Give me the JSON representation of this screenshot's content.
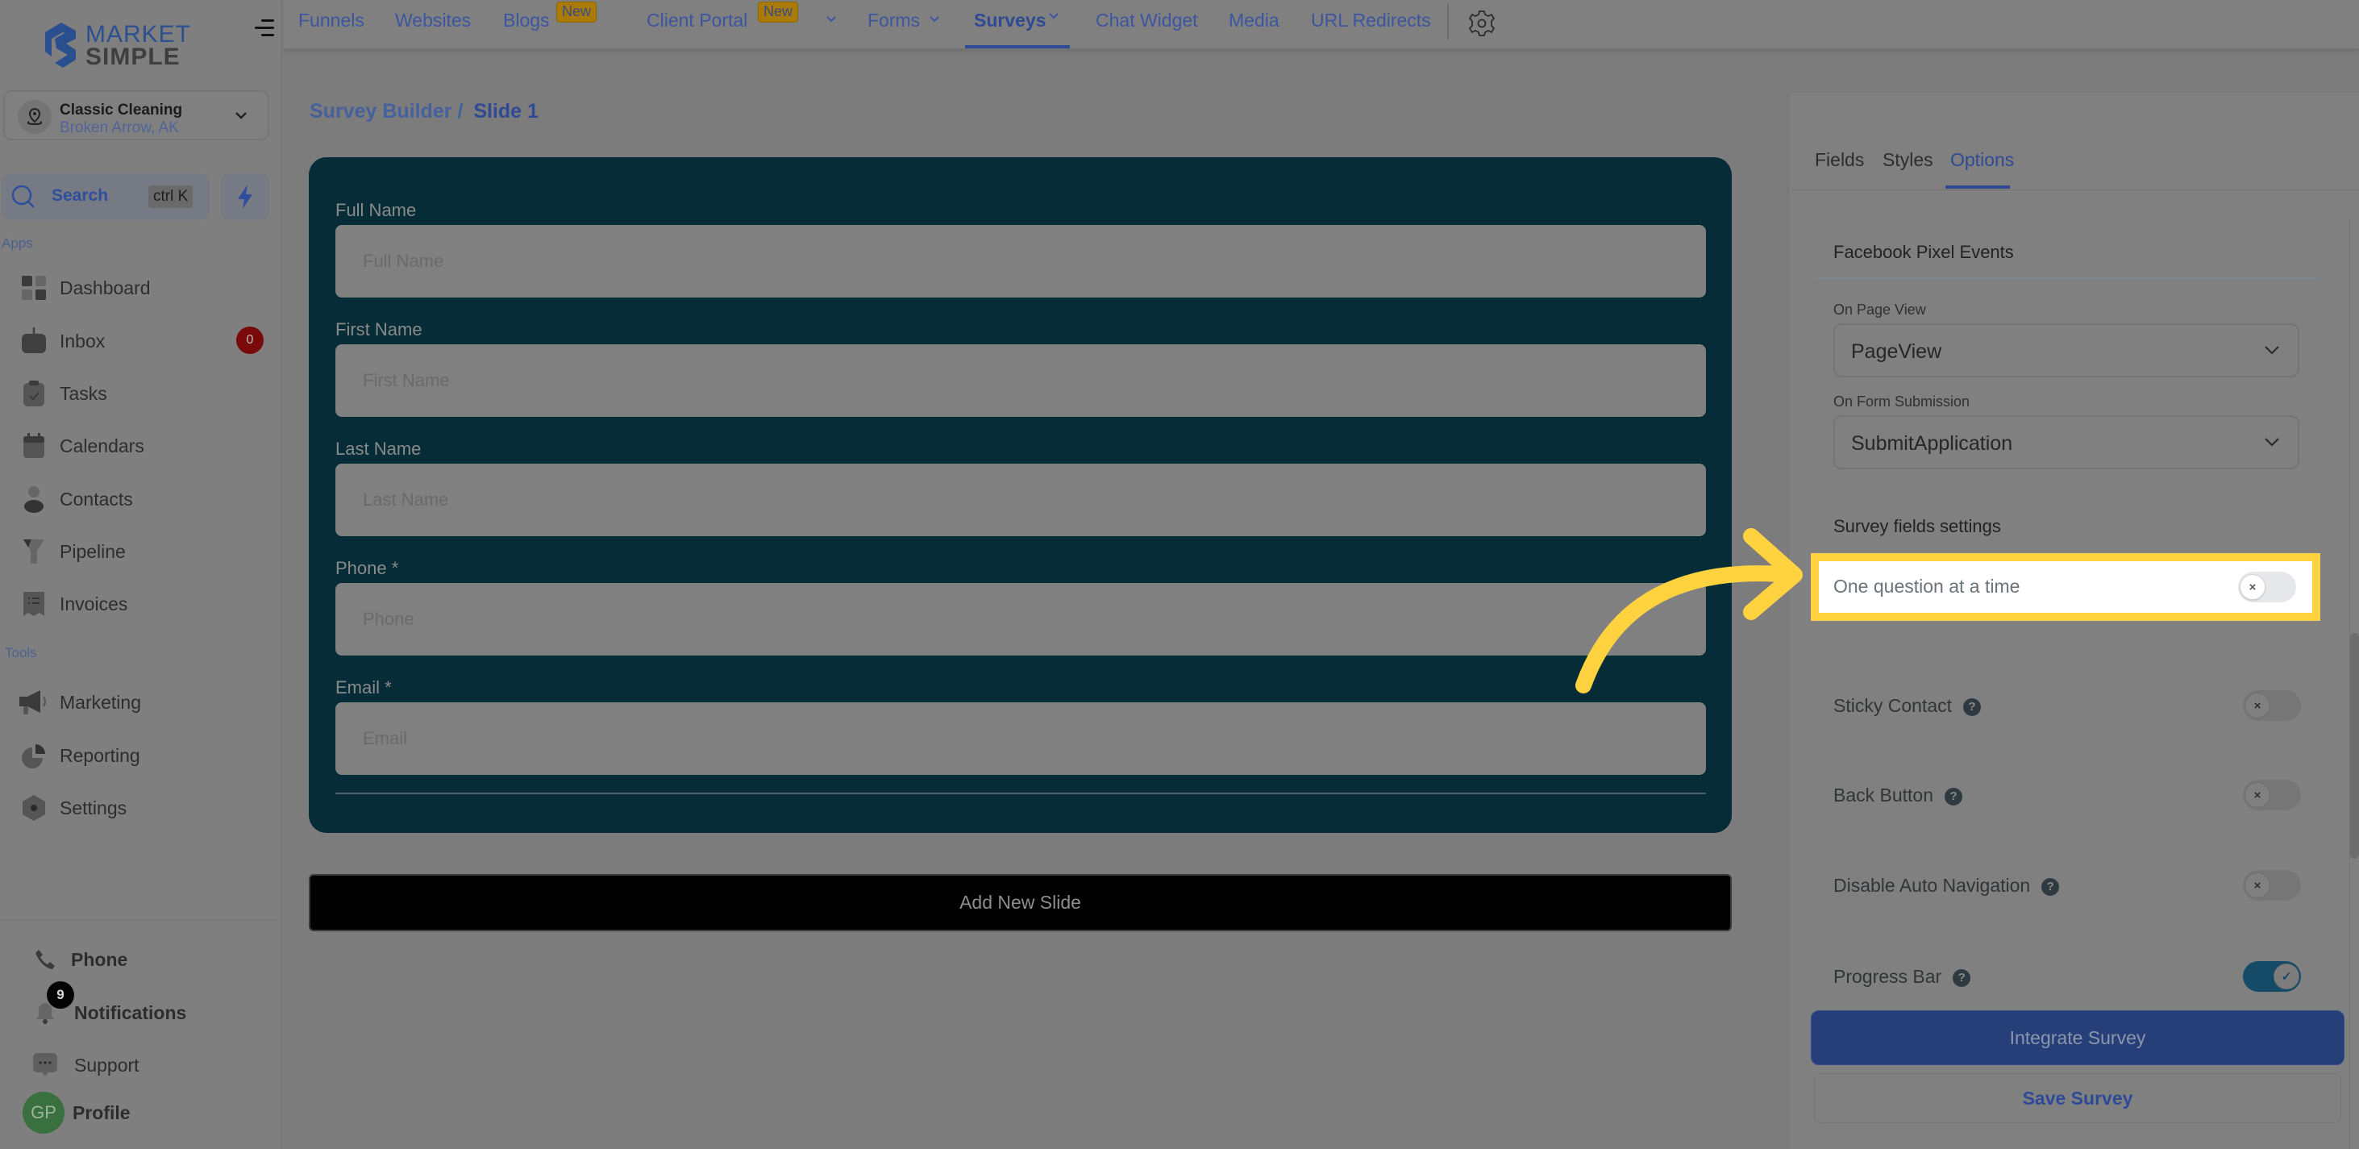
{
  "brand": {
    "logo_top": "MARKET",
    "logo_bottom": "SIMPLE"
  },
  "location": {
    "name": "Classic Cleaning",
    "city": "Broken Arrow, AK"
  },
  "search": {
    "label": "Search",
    "shortcut": "ctrl K"
  },
  "sidebar": {
    "apps_label": "Apps",
    "tools_label": "Tools",
    "apps": [
      {
        "label": "Dashboard",
        "icon": "dashboard-icon"
      },
      {
        "label": "Inbox",
        "icon": "inbox-icon",
        "badge": "0"
      },
      {
        "label": "Tasks",
        "icon": "tasks-icon"
      },
      {
        "label": "Calendars",
        "icon": "calendar-icon"
      },
      {
        "label": "Contacts",
        "icon": "contacts-icon"
      },
      {
        "label": "Pipeline",
        "icon": "pipeline-icon"
      },
      {
        "label": "Invoices",
        "icon": "invoices-icon"
      }
    ],
    "tools": [
      {
        "label": "Marketing",
        "icon": "megaphone-icon"
      },
      {
        "label": "Reporting",
        "icon": "pie-chart-icon"
      },
      {
        "label": "Settings",
        "icon": "settings-icon"
      }
    ],
    "bottom": [
      {
        "label": "Phone",
        "icon": "phone-icon"
      },
      {
        "label": "Notifications",
        "icon": "bell-icon",
        "badge": "9"
      },
      {
        "label": "Support",
        "icon": "chat-icon"
      },
      {
        "label": "Profile",
        "icon": "avatar",
        "initials": "GP"
      }
    ]
  },
  "topnav": {
    "items": [
      {
        "label": "Funnels"
      },
      {
        "label": "Websites"
      },
      {
        "label": "Blogs",
        "badge": "New"
      },
      {
        "label": "Client Portal",
        "badge": "New",
        "dropdown": true
      },
      {
        "label": "Forms",
        "dropdown": true
      },
      {
        "label": "Surveys",
        "dropdown": true,
        "active": true
      },
      {
        "label": "Chat Widget"
      },
      {
        "label": "Media"
      },
      {
        "label": "URL Redirects"
      }
    ]
  },
  "breadcrumb": {
    "parent": "Survey Builder /",
    "current": "Slide 1"
  },
  "form": {
    "fields": [
      {
        "label": "Full Name",
        "placeholder": "Full Name"
      },
      {
        "label": "First Name",
        "placeholder": "First Name"
      },
      {
        "label": "Last Name",
        "placeholder": "Last Name"
      },
      {
        "label": "Phone *",
        "placeholder": "Phone"
      },
      {
        "label": "Email *",
        "placeholder": "Email"
      }
    ],
    "add_slide_label": "Add New Slide"
  },
  "panel": {
    "tabs": [
      {
        "label": "Fields"
      },
      {
        "label": "Styles"
      },
      {
        "label": "Options",
        "active": true
      }
    ],
    "facebook": {
      "title": "Facebook Pixel Events",
      "page_view_label": "On Page View",
      "page_view_value": "PageView",
      "submission_label": "On Form Submission",
      "submission_value": "SubmitApplication"
    },
    "survey_settings_title": "Survey fields settings",
    "options": [
      {
        "label": "One question at a time",
        "enabled": false,
        "highlighted": true
      },
      {
        "label": "Sticky Contact",
        "enabled": false,
        "help": true
      },
      {
        "label": "Back Button",
        "enabled": false,
        "help": true
      },
      {
        "label": "Disable Auto Navigation",
        "enabled": false,
        "help": true
      },
      {
        "label": "Progress Bar",
        "enabled": true,
        "help": true
      }
    ],
    "toggle_off_glyph": "×",
    "toggle_on_glyph": "✓",
    "help_glyph": "?",
    "integrate_label": "Integrate Survey",
    "save_label": "Save Survey"
  },
  "colors": {
    "highlight": "#ffd23f",
    "card_bg": "#062d37",
    "accent": "#2f4a93"
  }
}
